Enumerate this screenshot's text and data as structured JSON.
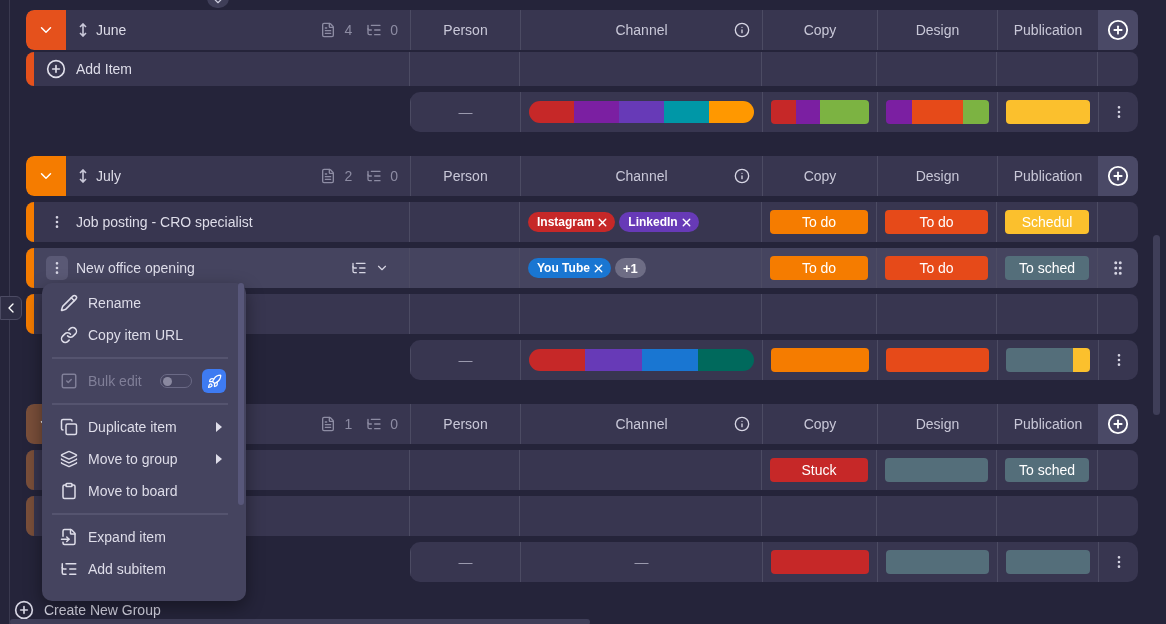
{
  "groups": [
    {
      "name": "June",
      "color": "#e5511c",
      "expanded": true,
      "item_count": "4",
      "subitem_count": "0",
      "columns": [
        "Person",
        "Channel",
        "Copy",
        "Design",
        "Publication"
      ],
      "rows": [
        {
          "kind": "add",
          "label": "Add Item"
        }
      ],
      "summary": {
        "person": "—",
        "channel": {
          "segments": [
            {
              "color": "#c62828"
            },
            {
              "color": "#7b1fa2"
            },
            {
              "color": "#673ab7"
            },
            {
              "color": "#0097a7"
            },
            {
              "color": "#ff9800"
            }
          ]
        },
        "copy": {
          "segments": [
            {
              "color": "#c62828"
            },
            {
              "color": "#7b1fa2"
            },
            {
              "color": "#7cb342"
            },
            {
              "color": "#7cb342"
            }
          ]
        },
        "design": {
          "segments": [
            {
              "color": "#7b1fa2"
            },
            {
              "color": "#e64a19"
            },
            {
              "color": "#e64a19"
            },
            {
              "color": "#7cb342"
            }
          ]
        },
        "publication": {
          "segments": [
            {
              "color": "#fbc02d"
            }
          ]
        }
      }
    },
    {
      "name": "July",
      "color": "#f57c00",
      "expanded": true,
      "item_count": "2",
      "subitem_count": "0",
      "columns": [
        "Person",
        "Channel",
        "Copy",
        "Design",
        "Publication"
      ],
      "rows": [
        {
          "kind": "item",
          "name": "Job posting - CRO specialist",
          "hovered": false,
          "tags": [
            {
              "label": "Instagram",
              "color": "#c62828"
            },
            {
              "label": "LinkedIn",
              "color": "#673ab7"
            }
          ],
          "copy": {
            "label": "To do",
            "color": "#f57c00"
          },
          "design": {
            "label": "To do",
            "color": "#e64a19"
          },
          "publication": {
            "label": "Schedul",
            "color": "#fbc02d"
          }
        },
        {
          "kind": "item",
          "name": "New office opening",
          "hovered": true,
          "tags": [
            {
              "label": "You Tube",
              "color": "#1976d2"
            }
          ],
          "more_tags": "+1",
          "copy": {
            "label": "To do",
            "color": "#f57c00"
          },
          "design": {
            "label": "To do",
            "color": "#e64a19"
          },
          "publication": {
            "label": "To sched",
            "color": "#546e7a"
          }
        },
        {
          "kind": "item",
          "hovered": false
        }
      ],
      "summary": {
        "person": "—",
        "channel": {
          "segments": [
            {
              "color": "#c62828"
            },
            {
              "color": "#673ab7"
            },
            {
              "color": "#1976d2"
            },
            {
              "color": "#00695c"
            }
          ]
        },
        "copy": {
          "segments": [
            {
              "color": "#f57c00"
            }
          ]
        },
        "design": {
          "segments": [
            {
              "color": "#e64a19"
            }
          ]
        },
        "publication": {
          "segments": [
            {
              "color": "#546e7a"
            },
            {
              "color": "#546e7a"
            },
            {
              "color": "#546e7a"
            },
            {
              "color": "#546e7a"
            },
            {
              "color": "#fbc02d"
            }
          ]
        }
      }
    },
    {
      "color": "#7a4f3a",
      "expanded": true,
      "item_count": "1",
      "subitem_count": "0",
      "columns": [
        "Person",
        "Channel",
        "Copy",
        "Design",
        "Publication"
      ],
      "rows": [
        {
          "kind": "item",
          "hovered": false,
          "copy": {
            "label": "Stuck",
            "color": "#c62828"
          },
          "design": {
            "color": "#546e7a"
          },
          "publication": {
            "label": "To sched",
            "color": "#546e7a"
          }
        },
        {
          "kind": "item",
          "hovered": false
        }
      ],
      "summary": {
        "person": "—",
        "channel": {
          "text": "—"
        },
        "copy": {
          "segments": [
            {
              "color": "#c62828"
            }
          ]
        },
        "design": {
          "segments": [
            {
              "color": "#546e7a"
            }
          ]
        },
        "publication": {
          "segments": [
            {
              "color": "#546e7a"
            }
          ]
        }
      }
    }
  ],
  "create_group": "Create New Group",
  "menu": {
    "sections": [
      [
        {
          "kind": "action",
          "label": "Rename",
          "disabled": false,
          "submenu": false
        },
        {
          "kind": "action",
          "label": "Copy item URL",
          "disabled": false,
          "submenu": false
        }
      ],
      [
        {
          "kind": "toggle",
          "label": "Bulk edit",
          "disabled": true,
          "submenu": false,
          "on": false
        }
      ],
      [
        {
          "kind": "action",
          "label": "Duplicate item",
          "disabled": false,
          "submenu": true
        },
        {
          "kind": "action",
          "label": "Move to group",
          "disabled": false,
          "submenu": true
        },
        {
          "kind": "action",
          "label": "Move to board",
          "disabled": false,
          "submenu": false
        }
      ],
      [
        {
          "kind": "action",
          "label": "Expand item",
          "disabled": false,
          "submenu": false
        },
        {
          "kind": "action",
          "label": "Add subitem",
          "disabled": false,
          "submenu": false
        }
      ]
    ]
  }
}
